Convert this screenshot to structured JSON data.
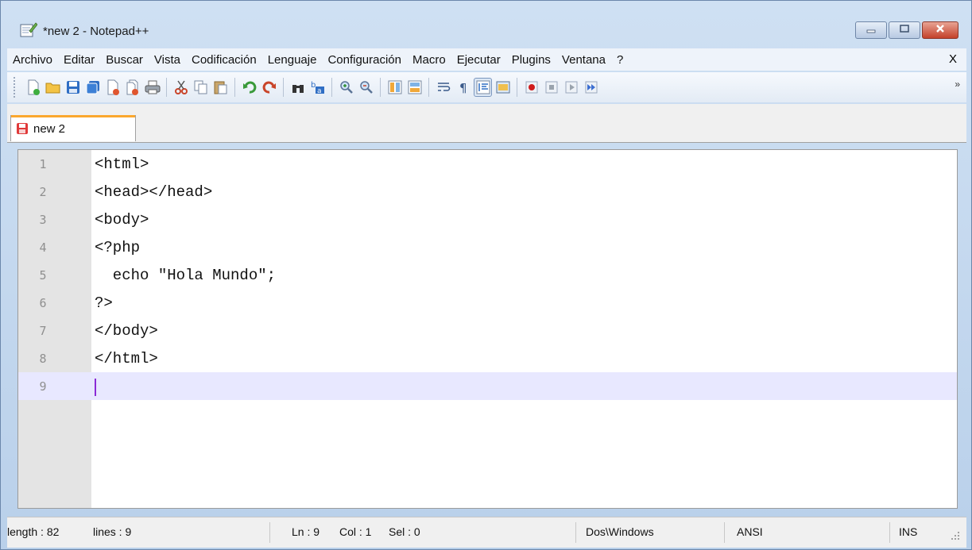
{
  "window": {
    "title": "*new 2 - Notepad++"
  },
  "menubar": {
    "items": [
      "Archivo",
      "Editar",
      "Buscar",
      "Vista",
      "Codificación",
      "Lenguaje",
      "Configuración",
      "Macro",
      "Ejecutar",
      "Plugins",
      "Ventana",
      "?"
    ],
    "close_label": "X"
  },
  "toolbar": {
    "icons": [
      "new-file-icon",
      "open-file-icon",
      "save-icon",
      "save-all-icon",
      "close-icon",
      "close-all-icon",
      "print-icon",
      "cut-icon",
      "copy-icon",
      "paste-icon",
      "undo-icon",
      "redo-icon",
      "find-icon",
      "replace-icon",
      "zoom-in-icon",
      "zoom-out-icon",
      "sync-vertical-icon",
      "sync-horizontal-icon",
      "word-wrap-icon",
      "show-all-chars-icon",
      "indent-guide-icon",
      "user-lang-icon",
      "record-macro-icon",
      "stop-record-icon",
      "play-macro-icon",
      "run-macro-multiple-icon"
    ],
    "more_label": "»"
  },
  "tabs": [
    {
      "label": "new 2",
      "icon": "unsaved-file-icon"
    }
  ],
  "editor": {
    "lines": [
      {
        "num": "1",
        "text": "<html>"
      },
      {
        "num": "2",
        "text": "<head></head>"
      },
      {
        "num": "3",
        "text": "<body>"
      },
      {
        "num": "4",
        "text": "<?php"
      },
      {
        "num": "5",
        "text": "  echo \"Hola Mundo\";"
      },
      {
        "num": "6",
        "text": "?>"
      },
      {
        "num": "7",
        "text": "</body>"
      },
      {
        "num": "8",
        "text": "</html>"
      },
      {
        "num": "9",
        "text": ""
      }
    ],
    "current_line": 9
  },
  "statusbar": {
    "length": "length : 82",
    "lines": "lines : 9",
    "ln": "Ln : 9",
    "col": "Col : 1",
    "sel": "Sel : 0",
    "eol": "Dos\\Windows",
    "encoding": "ANSI",
    "mode": "INS"
  },
  "colors": {
    "current_line": "#e8e8ff",
    "caret": "#8a2bd6",
    "tab_accent": "#fba72d",
    "gutter": "#e4e4e4"
  }
}
